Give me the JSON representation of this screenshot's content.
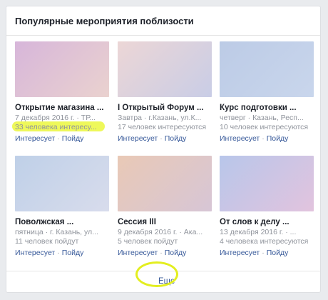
{
  "widget": {
    "title": "Популярные мероприятия поблизости",
    "more_label": "Еще"
  },
  "actions": {
    "interested": "Интересует",
    "separator": "·",
    "going": "Пойду"
  },
  "colors": {
    "link": "#365899",
    "muted": "#90949c",
    "highlight": "#eef85a"
  },
  "events": [
    {
      "title": "Открытие магазина ...",
      "date": "7 декабря 2016 г. · ТР...",
      "interest": "33 человека интересу...",
      "highlighted": true,
      "thumb_colors": [
        "#d7b6da",
        "#ead2cf"
      ]
    },
    {
      "title": "I Открытый Форум ...",
      "date": "Завтра · г.Казань, ул.К...",
      "interest": "17 человек интересуются",
      "highlighted": false,
      "thumb_colors": [
        "#ecd6d6",
        "#c9cde6"
      ]
    },
    {
      "title": "Курс подготовки ...",
      "date": "четверг · Казань, Респ...",
      "interest": "10 человек интересуются",
      "highlighted": false,
      "thumb_colors": [
        "#bccbe6",
        "#c9d6ec"
      ]
    },
    {
      "title": "Поволжская ...",
      "date": "пятница · г. Казань, ул...",
      "interest": "11 человек пойдут",
      "highlighted": false,
      "thumb_colors": [
        "#bfd0e8",
        "#d8dcec"
      ]
    },
    {
      "title": "Сессия III",
      "date": "9 декабря 2016 г. · Ака...",
      "interest": "5 человек пойдут",
      "highlighted": false,
      "thumb_colors": [
        "#e9c9b6",
        "#d7c6d6"
      ]
    },
    {
      "title": "От слов к делу ...",
      "date": "13 декабря 2016 г. · ...",
      "interest": "4 человека интересуются",
      "highlighted": false,
      "thumb_colors": [
        "#b8c6ea",
        "#e2c4de"
      ]
    }
  ]
}
